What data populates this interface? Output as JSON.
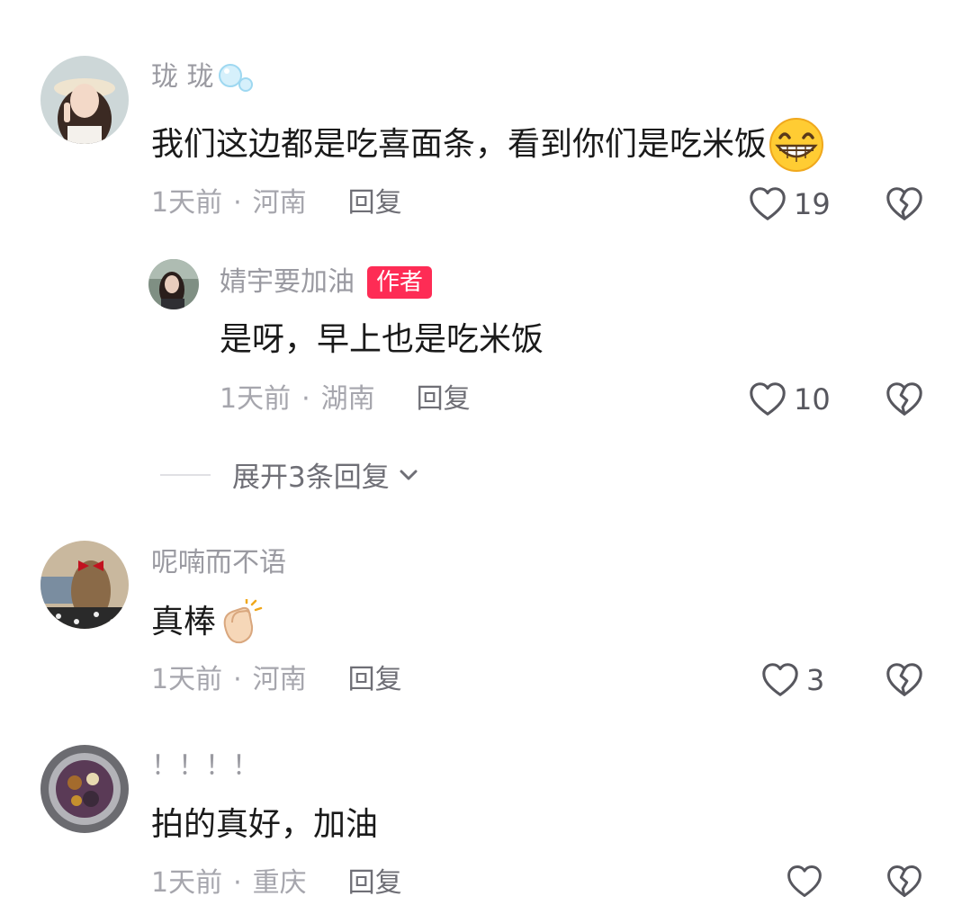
{
  "comments": [
    {
      "username": "珑 珑",
      "text": "我们这边都是吃喜面条，看到你们是吃米饭",
      "time": "1天前",
      "separator": "·",
      "location": "河南",
      "reply_label": "回复",
      "likes": "19",
      "emoji": "grin-emoji",
      "name_emoji": "bubbles-emoji"
    },
    {
      "username": "呢喃而不语",
      "text": "真棒",
      "time": "1天前",
      "separator": "·",
      "location": "河南",
      "reply_label": "回复",
      "likes": "3",
      "emoji": "clapping-hands-emoji"
    },
    {
      "username": "！！！！",
      "text": "拍的真好，加油",
      "time": "1天前",
      "separator": "·",
      "location": "重庆",
      "reply_label": "回复",
      "likes": ""
    }
  ],
  "reply": {
    "username": "婧宇要加油",
    "badge": "作者",
    "text": "是呀，早上也是吃米饭",
    "time": "1天前",
    "separator": "·",
    "location": "湖南",
    "reply_label": "回复",
    "likes": "10"
  },
  "expand_replies": "展开3条回复",
  "colors": {
    "accent": "#fe2c55",
    "name": "#9a9aa1",
    "text": "#1a1a1a",
    "meta": "#a6a6ad"
  }
}
